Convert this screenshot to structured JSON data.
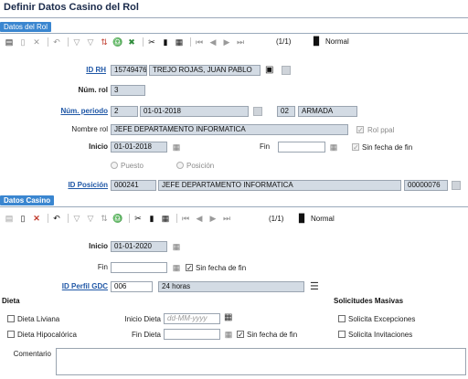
{
  "page": {
    "title": "Definir Datos Casino del Rol"
  },
  "tabs": {
    "rol": "Datos del Rol",
    "casino": "Datos Casino"
  },
  "toolbar1": {
    "record": "(1/1)",
    "mode": "Normal"
  },
  "toolbar2": {
    "record": "(1/1)",
    "mode": "Normal"
  },
  "rol": {
    "id_rh_label": "ID RH",
    "id_rh": "15749476",
    "nombre_persona": "TREJO ROJAS, JUAN PABLO",
    "num_rol_label": "Núm. rol",
    "num_rol": "3",
    "num_periodo_label": "Núm. periodo",
    "num_periodo": "2",
    "periodo_fecha": "01-01-2018",
    "rama_codigo": "02",
    "rama_nombre": "ARMADA",
    "nombre_rol_label": "Nombre rol",
    "nombre_rol": "JEFE DEPARTAMENTO INFORMATICA",
    "rol_ppal_label": "Rol ppal",
    "inicio_label": "Inicio",
    "inicio": "01-01-2018",
    "fin_label": "Fin",
    "fin": "",
    "sin_fecha_fin_label": "Sin fecha de fin",
    "puesto_label": "Puesto",
    "posicion_label": "Posición",
    "id_posicion_label": "ID Posición",
    "id_posicion": "000241",
    "posicion_nombre": "JEFE DEPARTAMENTO INFORMATICA",
    "posicion_codigo": "00000076"
  },
  "casino": {
    "inicio_label": "Inicio",
    "inicio": "01-01-2020",
    "fin_label": "Fin",
    "fin": "",
    "sin_fecha_fin_label": "Sin fecha de fin",
    "id_perfil_label": "ID Perfil GDC",
    "id_perfil": "006",
    "perfil_nombre": "24 horas",
    "dieta_title": "Dieta",
    "dieta_liviana_label": "Dieta Liviana",
    "dieta_hipocalorica_label": "Dieta Hipocalórica",
    "inicio_dieta_label": "Inicio Dieta",
    "inicio_dieta_placeholder": "dd-MM-yyyy",
    "fin_dieta_label": "Fin Dieta",
    "fin_dieta_sin_fecha_label": "Sin fecha de fin",
    "solicitudes_title": "Solicitudes Masivas",
    "solicita_excepciones_label": "Solicita Excepciones",
    "solicita_invitaciones_label": "Solicita Invitaciones",
    "comentario_label": "Comentario",
    "comentario": ""
  }
}
